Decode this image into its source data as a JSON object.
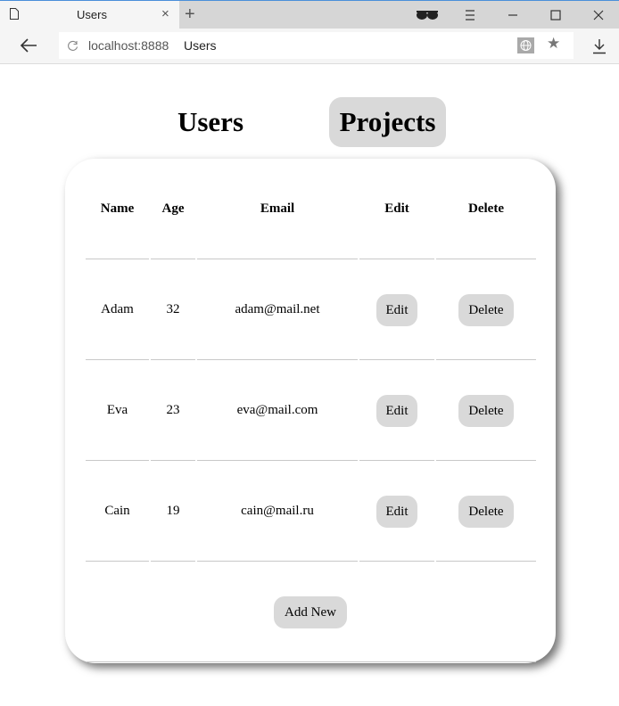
{
  "browser": {
    "tab_title": "Users",
    "tab_close": "×",
    "new_tab": "+",
    "url_host": "localhost:8888",
    "url_title": "Users"
  },
  "nav": {
    "users_label": "Users",
    "projects_label": "Projects"
  },
  "table": {
    "headers": [
      "Name",
      "Age",
      "Email",
      "Edit",
      "Delete"
    ],
    "rows": [
      {
        "name": "Adam",
        "age": "32",
        "email": "adam@mail.net",
        "edit": "Edit",
        "delete": "Delete"
      },
      {
        "name": "Eva",
        "age": "23",
        "email": "eva@mail.com",
        "edit": "Edit",
        "delete": "Delete"
      },
      {
        "name": "Cain",
        "age": "19",
        "email": "cain@mail.ru",
        "edit": "Edit",
        "delete": "Delete"
      }
    ],
    "add_new_label": "Add New"
  },
  "colors": {
    "button_bg": "#d9d9d9",
    "divider": "#c8c8c8"
  }
}
